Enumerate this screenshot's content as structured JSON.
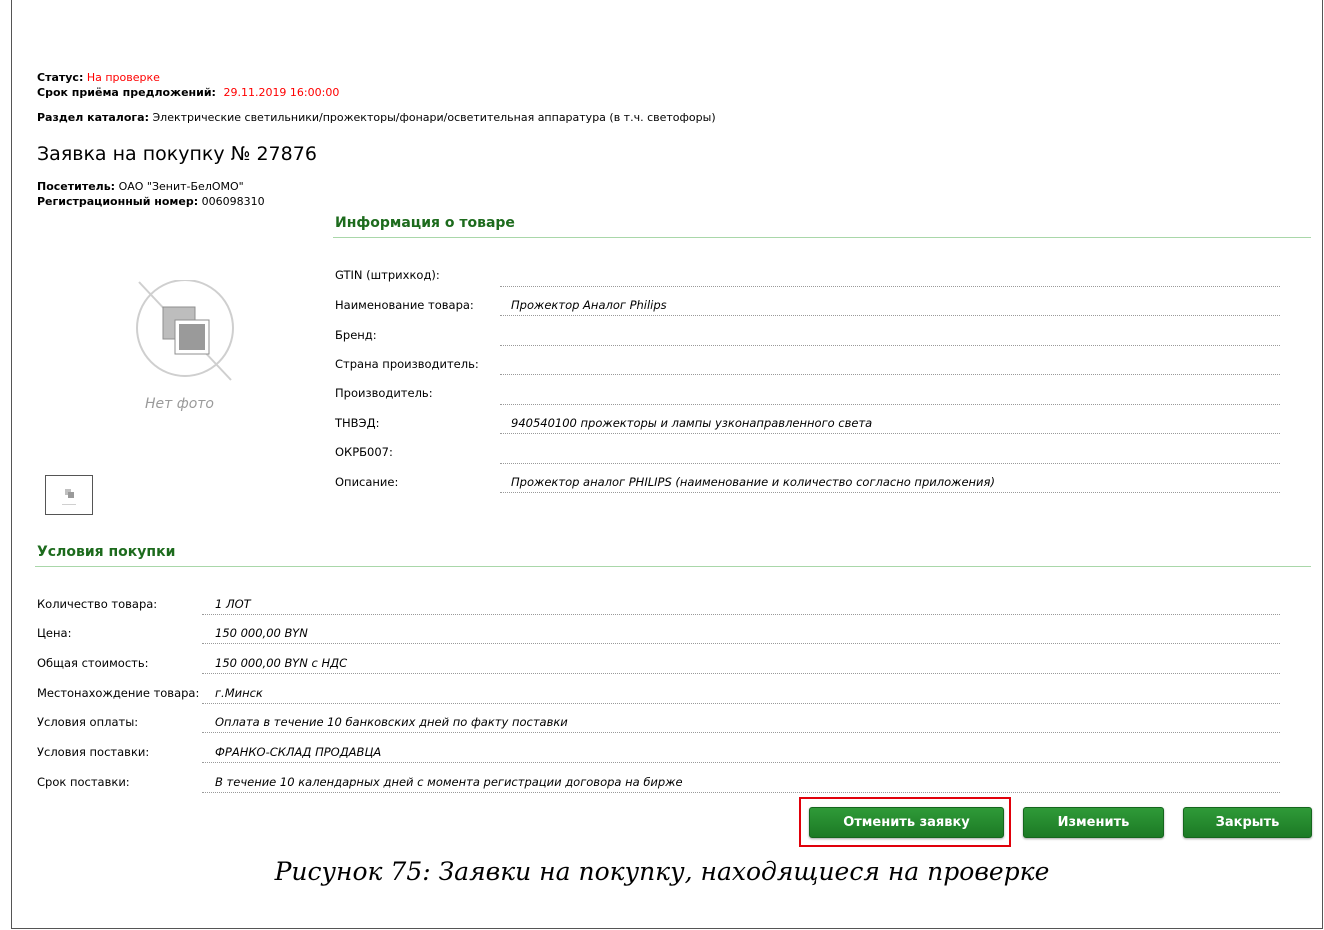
{
  "status": {
    "label": "Статус:",
    "value": "На проверке"
  },
  "deadline": {
    "label": "Срок приёма предложений:",
    "value": "29.11.2019 16:00:00"
  },
  "catalog": {
    "label": "Раздел каталога:",
    "value": "Электрические светильники/прожекторы/фонари/осветительная аппаратура (в т.ч. светофоры)"
  },
  "title": "Заявка на покупку № 27876",
  "visitor": {
    "label": "Посетитель:",
    "value": "ОАО \"Зенит-БелОМО\""
  },
  "regnum": {
    "label": "Регистрационный номер:",
    "value": "006098310"
  },
  "photo": {
    "no_photo_text": "Нет фото"
  },
  "product_info": {
    "heading": "Информация о товаре",
    "rows": [
      {
        "label": "GTIN (штрихкод):",
        "value": ""
      },
      {
        "label": "Наименование товара:",
        "value": "Прожектор Аналог Philips"
      },
      {
        "label": "Бренд:",
        "value": ""
      },
      {
        "label": "Страна производитель:",
        "value": ""
      },
      {
        "label": "Производитель:",
        "value": ""
      },
      {
        "label": "ТНВЭД:",
        "value": "940540100 прожекторы и лампы узконаправленного света"
      },
      {
        "label": "ОКРБ007:",
        "value": ""
      },
      {
        "label": "Описание:",
        "value": "Прожектор аналог PHILIPS (наименование и количество согласно приложения)"
      }
    ]
  },
  "purchase_terms": {
    "heading": "Условия покупки",
    "rows": [
      {
        "label": "Количество товара:",
        "value": "1 ЛОТ"
      },
      {
        "label": "Цена:",
        "value": "150 000,00 BYN"
      },
      {
        "label": "Общая стоимость:",
        "value": "150 000,00 BYN с НДС"
      },
      {
        "label": "Местонахождение товара:",
        "value": "г.Минск"
      },
      {
        "label": "Условия оплаты:",
        "value": "Оплата в течение 10 банковских дней по факту поставки"
      },
      {
        "label": "Условия поставки:",
        "value": "ФРАНКО-СКЛАД ПРОДАВЦА"
      },
      {
        "label": "Срок поставки:",
        "value": "В течение 10 календарных дней с момента регистрации договора на бирже"
      }
    ]
  },
  "buttons": {
    "cancel": "Отменить заявку",
    "edit": "Изменить",
    "close": "Закрыть"
  },
  "caption": "Рисунок 75: Заявки на покупку, находящиеся на проверке",
  "colors": {
    "accent_green": "#1d7b26",
    "status_red": "#ff0000",
    "highlight_red": "#e0000a"
  }
}
